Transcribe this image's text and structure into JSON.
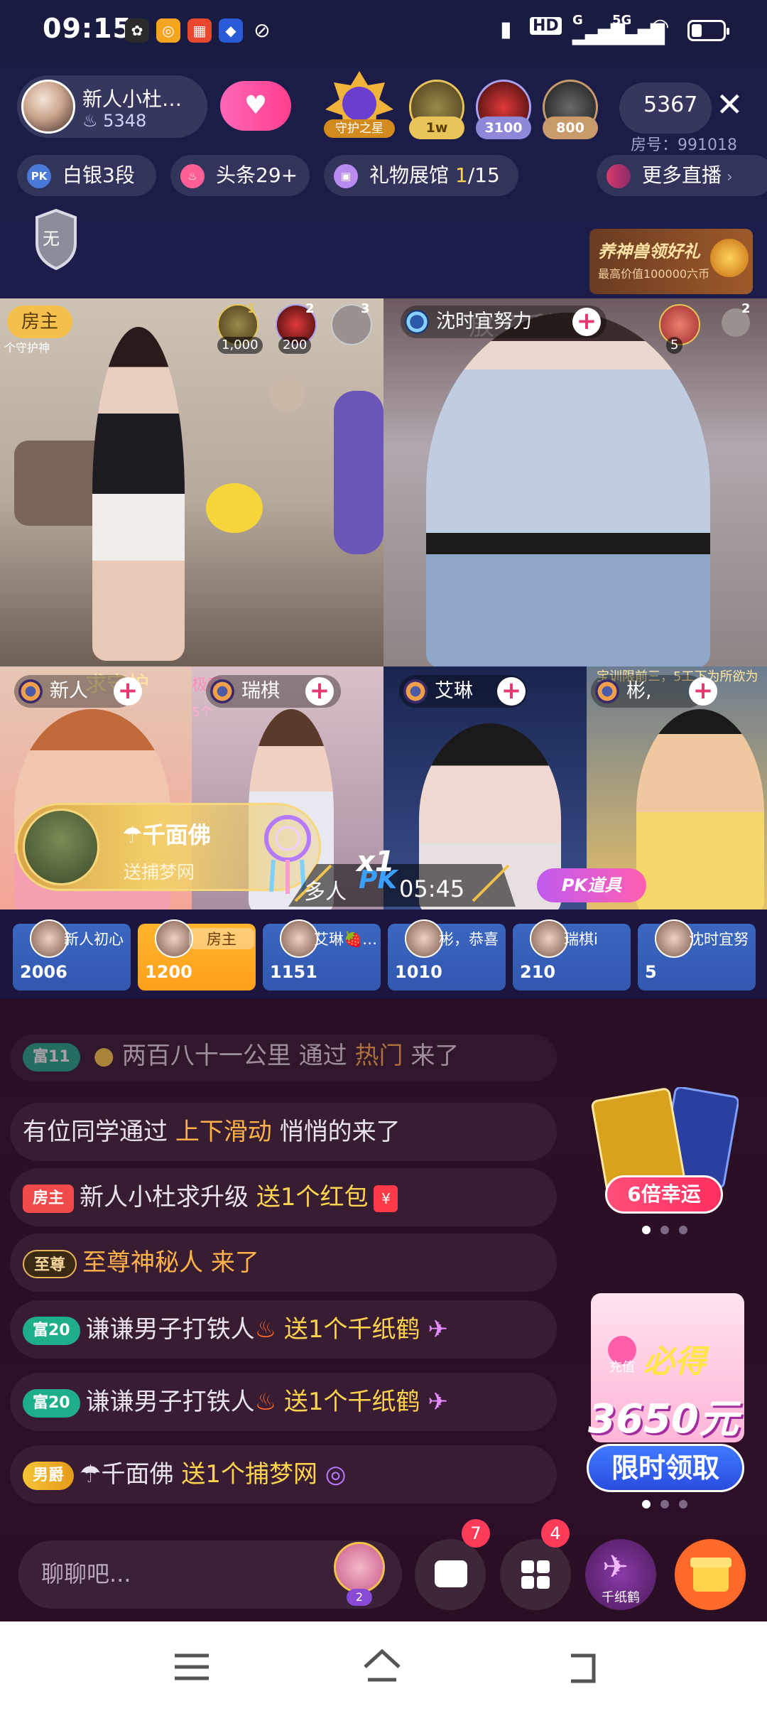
{
  "status_bar": {
    "time": "09:15",
    "network_labels": [
      "HD",
      "G",
      "5G"
    ]
  },
  "host": {
    "name": "新人小杜…",
    "score": "5348",
    "follow_icon": "heart-plus-icon"
  },
  "top_gifters": [
    {
      "label": "1w",
      "color": "#e9c45b"
    },
    {
      "label": "3100",
      "color": "#8e88d8"
    },
    {
      "label": "800",
      "color": "#c99a6a"
    }
  ],
  "guardian_label": "守护之星",
  "viewer_count": "5367",
  "room_number": "房号：991018",
  "chips": {
    "pk_rank_icon": "PK",
    "pk_rank": "白银3段",
    "headline": "头条29+",
    "gift_hall_label": "礼物展馆 ",
    "gift_hall_current": "1",
    "gift_hall_total": "/15",
    "more_live": "更多直播"
  },
  "rank_badge_text": "无",
  "promo": {
    "title": "养神兽领好礼",
    "subtitle": "最高价值100000六币"
  },
  "video_tiles": {
    "host_tag": "房主",
    "host_guard_text": "个守护神",
    "host_gifts": [
      {
        "rank": "1",
        "count": "1,000"
      },
      {
        "rank": "2",
        "count": "200"
      },
      {
        "rank": "3",
        "count": ""
      }
    ],
    "tile2_name": "沈时宜努力",
    "tile2_gift_count": "5",
    "tile2_sofa_rank": "2",
    "tile2_overlay_text": "放了话榜吧",
    "tile3_name": "新人",
    "tile3_overlay": "求守护",
    "tile4_name": "瑞棋",
    "tile4_overlay": "极呀",
    "tile4_overlay2": "5个",
    "tile5_name": "艾琳",
    "tile6_name": "彬,",
    "tile6_overlay": "宝训限前三，5工下为所欲为"
  },
  "gift_toast": {
    "sender": "千面佛",
    "action": "送捕梦网"
  },
  "pk": {
    "mode": "多人",
    "logo": "PK",
    "multiplier": "x1",
    "countdown": "05:45",
    "tool_label": "PK道具"
  },
  "score_cards": [
    {
      "name": "新人初心",
      "value": "2006",
      "is_host": false
    },
    {
      "name": "房主",
      "value": "1200",
      "is_host": true
    },
    {
      "name": "艾琳🍓…",
      "value": "1151",
      "is_host": false
    },
    {
      "name": "彬，恭喜",
      "value": "1010",
      "is_host": false
    },
    {
      "name": "瑞棋i",
      "value": "210",
      "is_host": false
    },
    {
      "name": "沈时宜努",
      "value": "5",
      "is_host": false
    }
  ],
  "chat": [
    {
      "badge": "富11",
      "parts": [
        "两百八十一公里",
        " 通过 ",
        "热门",
        " 来了"
      ]
    },
    {
      "badge": "",
      "parts": [
        "有位同学通过 ",
        "上下滑动",
        " 悄悄的来了"
      ]
    },
    {
      "badge": "房主",
      "parts": [
        "新人小杜求升级 ",
        "送1个红包"
      ]
    },
    {
      "badge": "至尊",
      "parts": [
        "至尊神秘人 来了"
      ]
    },
    {
      "badge": "富20",
      "parts": [
        "谦谦男子打铁人",
        "送1个千纸鹤"
      ]
    },
    {
      "badge": "富20",
      "parts": [
        "谦谦男子打铁人",
        "送1个千纸鹤"
      ]
    },
    {
      "badge": "男爵",
      "parts": [
        "千面佛 ",
        "送1个捕梦网"
      ]
    }
  ],
  "side_promos": {
    "fortune_label": "6倍幸运",
    "recharge_small": "充值",
    "recharge_big": "必得",
    "recharge_amount": "3650元",
    "recharge_button": "限时领取"
  },
  "bottom_bar": {
    "input_placeholder": "聊聊吧...",
    "throne_badge": "2",
    "chat_badge": "7",
    "more_badge": "4",
    "crane_label": "千纸鹤"
  },
  "colors": {
    "accent_gold": "#ffd34d",
    "score_blue": "#3a67c0",
    "host_orange": "#ffa825",
    "pink": "#ff3f8e"
  }
}
